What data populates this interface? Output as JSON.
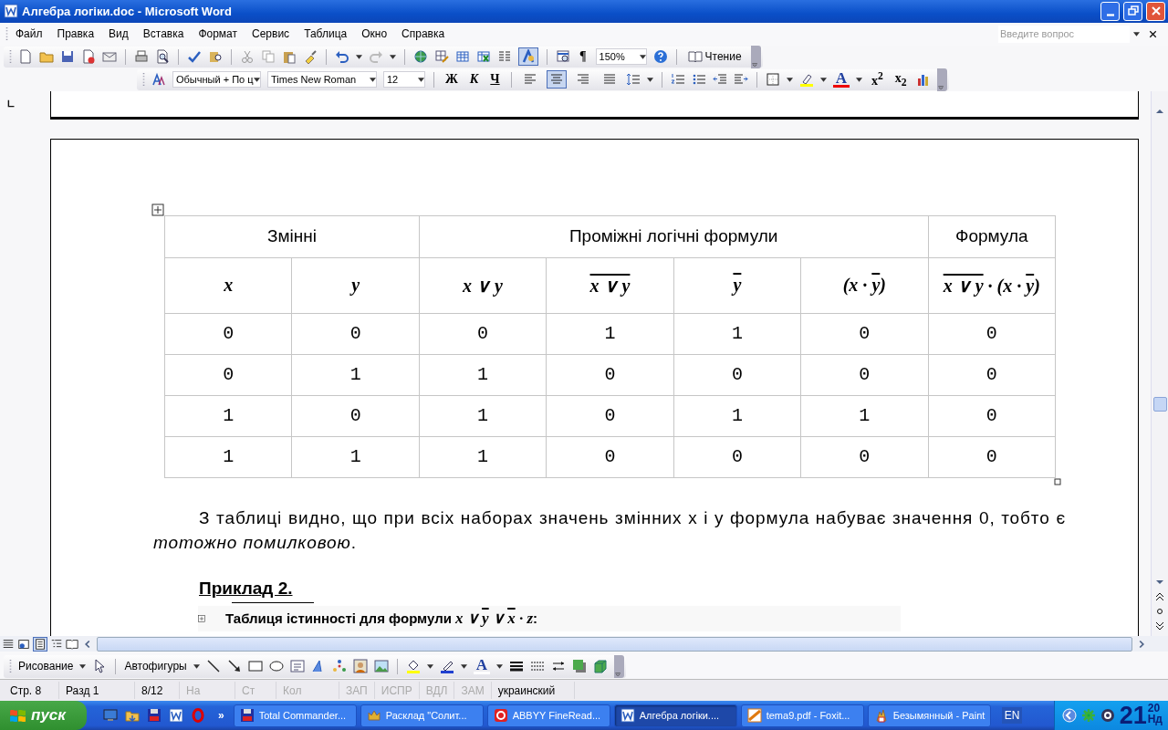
{
  "window": {
    "title": "Алгебра логіки.doc - Microsoft Word"
  },
  "menu": [
    "Файл",
    "Правка",
    "Вид",
    "Вставка",
    "Формат",
    "Сервис",
    "Таблица",
    "Окно",
    "Справка"
  ],
  "help_search": {
    "placeholder": "Введите вопрос"
  },
  "standard_toolbar": {
    "drawing_pressed": true,
    "pilcrow": "¶",
    "zoom": "150%",
    "read": "Чтение"
  },
  "formatting_toolbar": {
    "style": "Обычный + По ц",
    "font": "Times New Roman",
    "size": "12",
    "bold": "Ж",
    "italic": "К",
    "underline": "Ч",
    "align": [
      {
        "selected": false
      },
      {
        "selected": true
      },
      {
        "selected": false
      },
      {
        "selected": false
      }
    ],
    "font_color": "A",
    "superscript": "x$^{2}$",
    "subscript": "x$_{2}$"
  },
  "document": {
    "table": {
      "groups": [
        {
          "text": "Змінні",
          "columns": [
            [
              {
                "text": "x",
                "over": false
              }
            ],
            [
              {
                "text": "y",
                "over": false
              }
            ]
          ]
        },
        {
          "text": "Проміжні логічні формули",
          "columns": [
            [
              {
                "text": "x ∨ y",
                "over": false
              }
            ],
            [
              {
                "text": "x ∨ y",
                "over": true
              }
            ],
            [
              {
                "text": "y",
                "over": true
              }
            ],
            [
              {
                "text": "(x · ",
                "over": false
              },
              {
                "text": "y",
                "over": true
              },
              {
                "text": ")",
                "over": false
              }
            ]
          ]
        },
        {
          "text": "Формула",
          "columns": [
            [
              {
                "text": "x ∨ y",
                "over": true
              },
              {
                "text": " · (x · ",
                "over": false
              },
              {
                "text": "y",
                "over": true
              },
              {
                "text": ")",
                "over": false
              }
            ]
          ]
        }
      ],
      "rows": [
        [
          "0",
          "0",
          "0",
          "1",
          "1",
          "0",
          "0"
        ],
        [
          "0",
          "1",
          "1",
          "0",
          "0",
          "0",
          "0"
        ],
        [
          "1",
          "0",
          "1",
          "0",
          "1",
          "1",
          "0"
        ],
        [
          "1",
          "1",
          "1",
          "0",
          "0",
          "0",
          "0"
        ]
      ]
    },
    "paragraph": "З таблиці видно, що при всіх наборах значень змінних x і y формула набуває значення 0, тобто є *тотожно помилковою*.",
    "heading": "Приклад 2.",
    "caption": {
      "text": "Таблиця істинності для формули",
      "formula": [
        {
          "text": "x ∨ ",
          "over": false
        },
        {
          "text": "y",
          "over": true
        },
        {
          "text": " ∨ ",
          "over": false
        },
        {
          "text": "x",
          "over": true
        },
        {
          "text": " · z",
          "over": false
        }
      ],
      "end": ":"
    }
  },
  "drawing_toolbar": {
    "draw": "Рисование",
    "autoshapes": "Автофигуры",
    "font_color": "A"
  },
  "status_bar": [
    {
      "text": "Стр. 8",
      "disabled": false
    },
    {
      "text": "Разд 1",
      "disabled": false
    },
    {
      "text": "8/12",
      "disabled": false
    },
    {
      "text": "На",
      "disabled": true
    },
    {
      "text": "Ст",
      "disabled": true
    },
    {
      "text": "Кол",
      "disabled": true
    },
    {
      "text": "ЗАП",
      "disabled": true
    },
    {
      "text": "ИСПР",
      "disabled": true
    },
    {
      "text": "ВДЛ",
      "disabled": true
    },
    {
      "text": "ЗАМ",
      "disabled": true
    },
    {
      "text": "украинский",
      "disabled": false
    }
  ],
  "taskbar": {
    "start": "пуск",
    "more": "»",
    "tasks": [
      {
        "label": "Total Commander...",
        "selected": false
      },
      {
        "label": "Расклад \"Солит...",
        "selected": false
      },
      {
        "label": "ABBYY FineRead...",
        "selected": false
      },
      {
        "label": "Алгебра логіки....",
        "selected": true
      },
      {
        "label": "tema9.pdf - Foxit...",
        "selected": false
      },
      {
        "label": "Безымянный - Paint",
        "selected": false
      }
    ],
    "language": "EN",
    "clock": {
      "hour": "21",
      "minute": "20",
      "day": "Нд"
    }
  }
}
